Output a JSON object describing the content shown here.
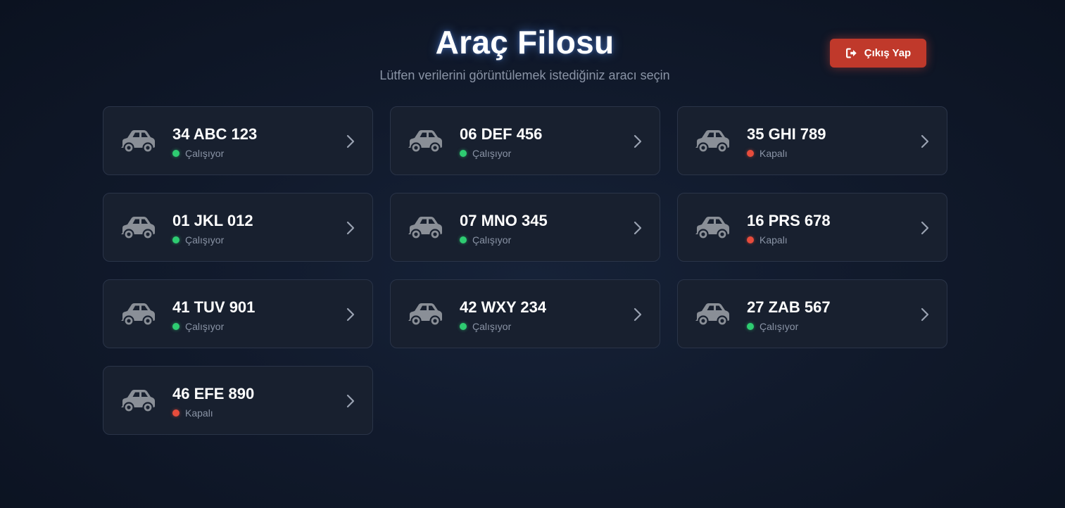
{
  "header": {
    "title": "Araç Filosu",
    "subtitle": "Lütfen verilerini görüntülemek istediğiniz aracı seçin"
  },
  "logout": {
    "label": "Çıkış Yap",
    "icon": "logout-icon",
    "color": "#c0392b"
  },
  "colors": {
    "running": "#2ecc71",
    "off": "#e74c3c",
    "card_bg": "#18202f"
  },
  "vehicles": [
    {
      "plate": "34 ABC 123",
      "status": "Çalışıyor",
      "state": "on"
    },
    {
      "plate": "06 DEF 456",
      "status": "Çalışıyor",
      "state": "on"
    },
    {
      "plate": "35 GHI 789",
      "status": "Kapalı",
      "state": "off"
    },
    {
      "plate": "01 JKL 012",
      "status": "Çalışıyor",
      "state": "on"
    },
    {
      "plate": "07 MNO 345",
      "status": "Çalışıyor",
      "state": "on"
    },
    {
      "plate": "16 PRS 678",
      "status": "Kapalı",
      "state": "off"
    },
    {
      "plate": "41 TUV 901",
      "status": "Çalışıyor",
      "state": "on"
    },
    {
      "plate": "42 WXY 234",
      "status": "Çalışıyor",
      "state": "on"
    },
    {
      "plate": "27 ZAB 567",
      "status": "Çalışıyor",
      "state": "on"
    },
    {
      "plate": "46 EFE 890",
      "status": "Kapalı",
      "state": "off"
    }
  ]
}
